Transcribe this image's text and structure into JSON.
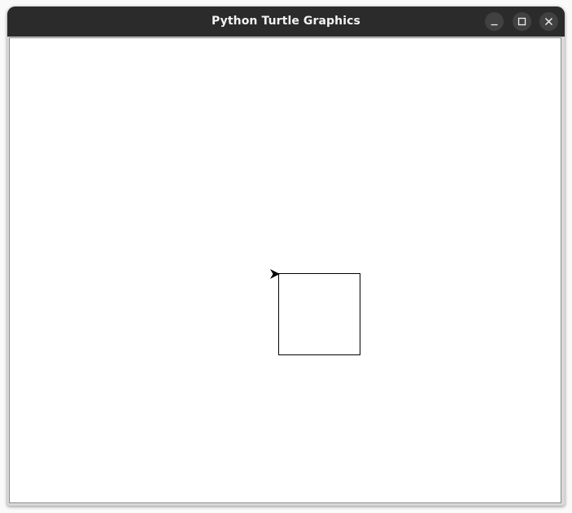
{
  "window": {
    "title": "Python Turtle Graphics"
  },
  "controls": {
    "minimize": "minimize-icon",
    "maximize": "maximize-icon",
    "close": "close-icon"
  },
  "canvas": {
    "background": "#ffffff",
    "drawing": {
      "shape": "square",
      "stroke_color": "#000000"
    },
    "turtle": {
      "shape": "arrow",
      "heading": "east",
      "color": "#000000"
    }
  }
}
